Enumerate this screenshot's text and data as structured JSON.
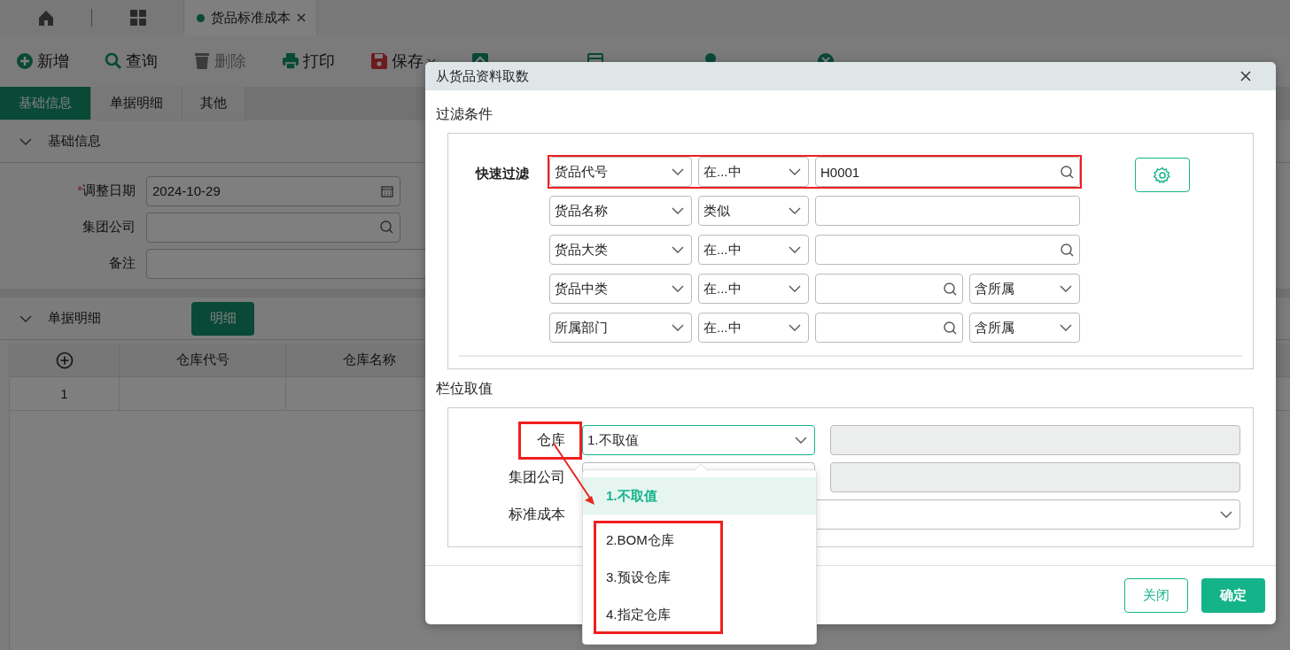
{
  "page_tabs": [
    {
      "kind": "home",
      "selected": false
    },
    {
      "kind": "apps",
      "selected": false
    },
    {
      "kind": "document",
      "label": "货品标准成本",
      "selected": true
    }
  ],
  "toolbar": [
    {
      "kind": "add",
      "label": "新增",
      "disabled": false,
      "dropdown": false
    },
    {
      "kind": "search",
      "label": "查询",
      "disabled": false,
      "dropdown": false
    },
    {
      "kind": "delete",
      "label": "删除",
      "disabled": true,
      "dropdown": false
    },
    {
      "kind": "print",
      "label": "打印",
      "disabled": false,
      "dropdown": false
    },
    {
      "kind": "save",
      "label": "保存",
      "disabled": false,
      "dropdown": true
    },
    {
      "kind": "submit"
    },
    {
      "kind": "linked"
    },
    {
      "kind": "fetch"
    },
    {
      "kind": "close"
    }
  ],
  "form_tabs": [
    {
      "label": "基础信息",
      "selected": true
    },
    {
      "label": "单据明细",
      "selected": false
    },
    {
      "label": "其他",
      "selected": false
    }
  ],
  "basic_section": {
    "title": "基础信息",
    "expanded": true,
    "fields": [
      {
        "label": "调整日期",
        "required_mark": "*",
        "kind": "date",
        "value": "2024-10-29"
      },
      {
        "label": "集团公司",
        "kind": "lookup"
      },
      {
        "label": "备注",
        "kind": "text"
      }
    ]
  },
  "detail_section": {
    "title": "单据明细",
    "expanded": true,
    "button": "明细",
    "columns": [
      "仓库代号",
      "仓库名称"
    ],
    "rows": [
      {
        "index": "1"
      }
    ]
  },
  "dialog": {
    "title": "从货品资料取数",
    "filter": {
      "heading": "过滤条件",
      "label": "快速过滤",
      "rows": [
        {
          "field": "货品代号",
          "operator": "在...中",
          "value": "H0001",
          "lookup": true,
          "highlighted": true
        },
        {
          "field": "货品名称",
          "operator": "类似",
          "lookup": false,
          "highlighted": false
        },
        {
          "field": "货品大类",
          "operator": "在...中",
          "lookup": true,
          "highlighted": false
        },
        {
          "field": "货品中类",
          "operator": "在...中",
          "lookup": true,
          "scope": "含所属",
          "highlighted": false
        },
        {
          "field": "所属部门",
          "operator": "在...中",
          "lookup": true,
          "scope": "含所属",
          "highlighted": false
        }
      ]
    },
    "values": {
      "heading": "栏位取值",
      "rows": [
        {
          "label": "仓库",
          "kind": "select-with-text",
          "value": "1.不取值",
          "open": true,
          "highlighted": true
        },
        {
          "label": "集团公司",
          "kind": "select-with-text",
          "open": false,
          "highlighted": false
        },
        {
          "label": "标准成本",
          "kind": "select-wide",
          "open": false,
          "highlighted": false
        }
      ]
    },
    "dropdown": {
      "options": [
        {
          "label": "1.不取值",
          "selected": true,
          "highlighted": false
        },
        {
          "label": "2.BOM仓库",
          "selected": false,
          "highlighted": true
        },
        {
          "label": "3.预设仓库",
          "selected": false,
          "highlighted": true
        },
        {
          "label": "4.指定仓库",
          "selected": false,
          "highlighted": true
        }
      ]
    },
    "buttons": [
      {
        "label": "关闭",
        "kind": "secondary"
      },
      {
        "label": "确定",
        "kind": "primary"
      }
    ]
  }
}
